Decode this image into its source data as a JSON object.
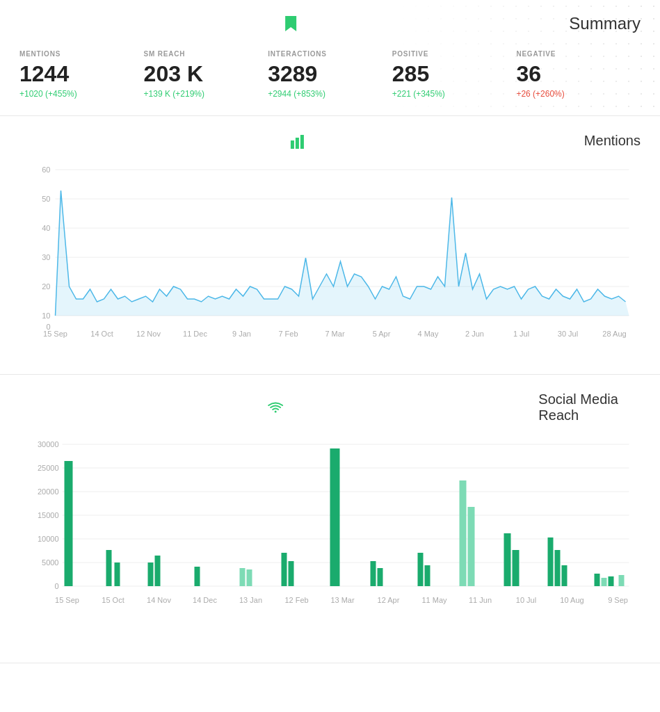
{
  "summary": {
    "title": "Summary",
    "metrics": [
      {
        "id": "mentions",
        "label": "MENTIONS",
        "value": "1244",
        "change": "+1020 (+455%)",
        "change_type": "positive"
      },
      {
        "id": "sm_reach",
        "label": "SM REACH",
        "value": "203 K",
        "change": "+139 K (+219%)",
        "change_type": "positive"
      },
      {
        "id": "interactions",
        "label": "INTERACTIONS",
        "value": "3289",
        "change": "+2944 (+853%)",
        "change_type": "positive"
      },
      {
        "id": "positive",
        "label": "POSITIVE",
        "value": "285",
        "change": "+221 (+345%)",
        "change_type": "positive"
      },
      {
        "id": "negative",
        "label": "NEGATIVE",
        "value": "36",
        "change": "+26 (+260%)",
        "change_type": "negative"
      }
    ]
  },
  "mentions_chart": {
    "title": "Mentions",
    "x_labels": [
      "15 Sep",
      "14 Oct",
      "12 Nov",
      "11 Dec",
      "9 Jan",
      "7 Feb",
      "7 Mar",
      "5 Apr",
      "4 May",
      "2 Jun",
      "1 Jul",
      "30 Jul",
      "28 Aug"
    ],
    "y_labels": [
      "0",
      "10",
      "20",
      "30",
      "40",
      "50",
      "60"
    ],
    "max_y": 60
  },
  "social_reach_chart": {
    "title": "Social Media Reach",
    "x_labels": [
      "15 Sep",
      "15 Oct",
      "14 Nov",
      "14 Dec",
      "13 Jan",
      "12 Feb",
      "13 Mar",
      "12 Apr",
      "11 May",
      "11 Jun",
      "10 Jul",
      "10 Aug",
      "9 Sep"
    ],
    "y_labels": [
      "0",
      "5000",
      "10000",
      "15000",
      "20000",
      "25000",
      "30000"
    ],
    "max_y": 30000
  }
}
